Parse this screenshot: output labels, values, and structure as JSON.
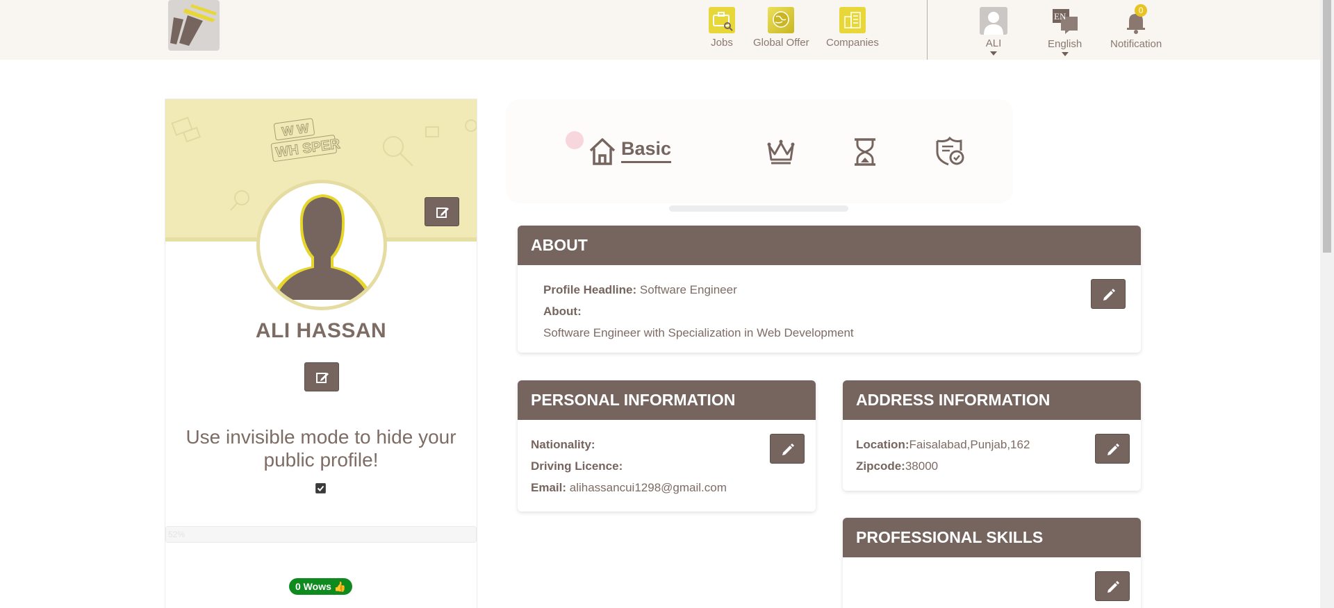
{
  "nav": {
    "logo": "app-logo",
    "items": [
      {
        "label": "Jobs",
        "icon": "briefcase-search-icon"
      },
      {
        "label": "Global Offer",
        "icon": "globe-icon"
      },
      {
        "label": "Companies",
        "icon": "buildings-icon"
      }
    ],
    "user": {
      "label": "ALI",
      "icon": "user-avatar-icon"
    },
    "language": {
      "label": "English",
      "icon": "language-icon",
      "badge_text": "EN"
    },
    "notification": {
      "label": "Notification",
      "icon": "bell-icon",
      "count": "0"
    }
  },
  "profile": {
    "cover_logo_line1": "W W",
    "cover_logo_line2": "WH SPER",
    "name": "ALI HASSAN",
    "invisible_mode_text": "Use invisible mode to hide your public profile!",
    "invisible_mode_checked": true,
    "progress_label": "52%",
    "progress_value": 0.52,
    "wows_label": "0 Wows"
  },
  "tabs": {
    "active_label": "Basic",
    "items": [
      {
        "name": "basic",
        "icon": "home-icon"
      },
      {
        "name": "premium",
        "icon": "crown-icon"
      },
      {
        "name": "experience",
        "icon": "hourglass-icon"
      },
      {
        "name": "verification",
        "icon": "shield-check-icon"
      }
    ]
  },
  "about": {
    "title": "ABOUT",
    "headline_label": "Profile Headline:",
    "headline_value": "Software Engineer",
    "about_label": "About:",
    "about_value": "Software Engineer with Specialization in Web Development"
  },
  "personal": {
    "title": "PERSONAL INFORMATION",
    "nationality_label": "Nationality:",
    "nationality_value": "",
    "driving_label": "Driving Licence:",
    "driving_value": "",
    "email_label": "Email:",
    "email_value": "alihassancui1298@gmail.com"
  },
  "address": {
    "title": "ADDRESS INFORMATION",
    "location_label": "Location:",
    "location_value": "Faisalabad,Punjab,162",
    "zipcode_label": "Zipcode:",
    "zipcode_value": "38000"
  },
  "skills": {
    "title": "PROFESSIONAL SKILLS"
  },
  "colors": {
    "brand_brown": "#76655e",
    "accent_yellow": "#e8d738",
    "cover_bg": "#f1eab7",
    "wows_green": "#0f8a1f"
  }
}
